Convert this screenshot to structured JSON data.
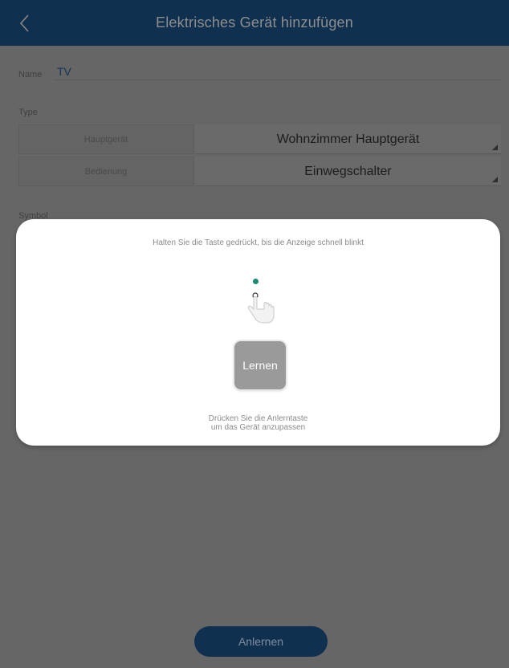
{
  "header": {
    "title": "Elektrisches Gerät hinzufügen",
    "back_icon": "chevron-left-icon"
  },
  "form": {
    "name_label": "Name",
    "name_value": "TV",
    "type_label": "Type",
    "rows": [
      {
        "label": "Hauptgerät",
        "value": "Wohnzimmer Hauptgerät"
      },
      {
        "label": "Bedienung",
        "value": "Einwegschalter"
      }
    ],
    "symbol_label": "Symbol"
  },
  "dialog": {
    "instruction": "Halten Sie die Taste gedrückt, bis die Anzeige schnell blinkt",
    "learn_button": "Lernen",
    "hint_line1": "Drücken Sie die Anlerntaste",
    "hint_line2": "um das Gerät anzupassen",
    "indicator_color": "#1a8c72"
  },
  "footer": {
    "anlernen_label": "Anlernen"
  },
  "colors": {
    "header_bg": "#10304f",
    "overlay": "#666666"
  }
}
